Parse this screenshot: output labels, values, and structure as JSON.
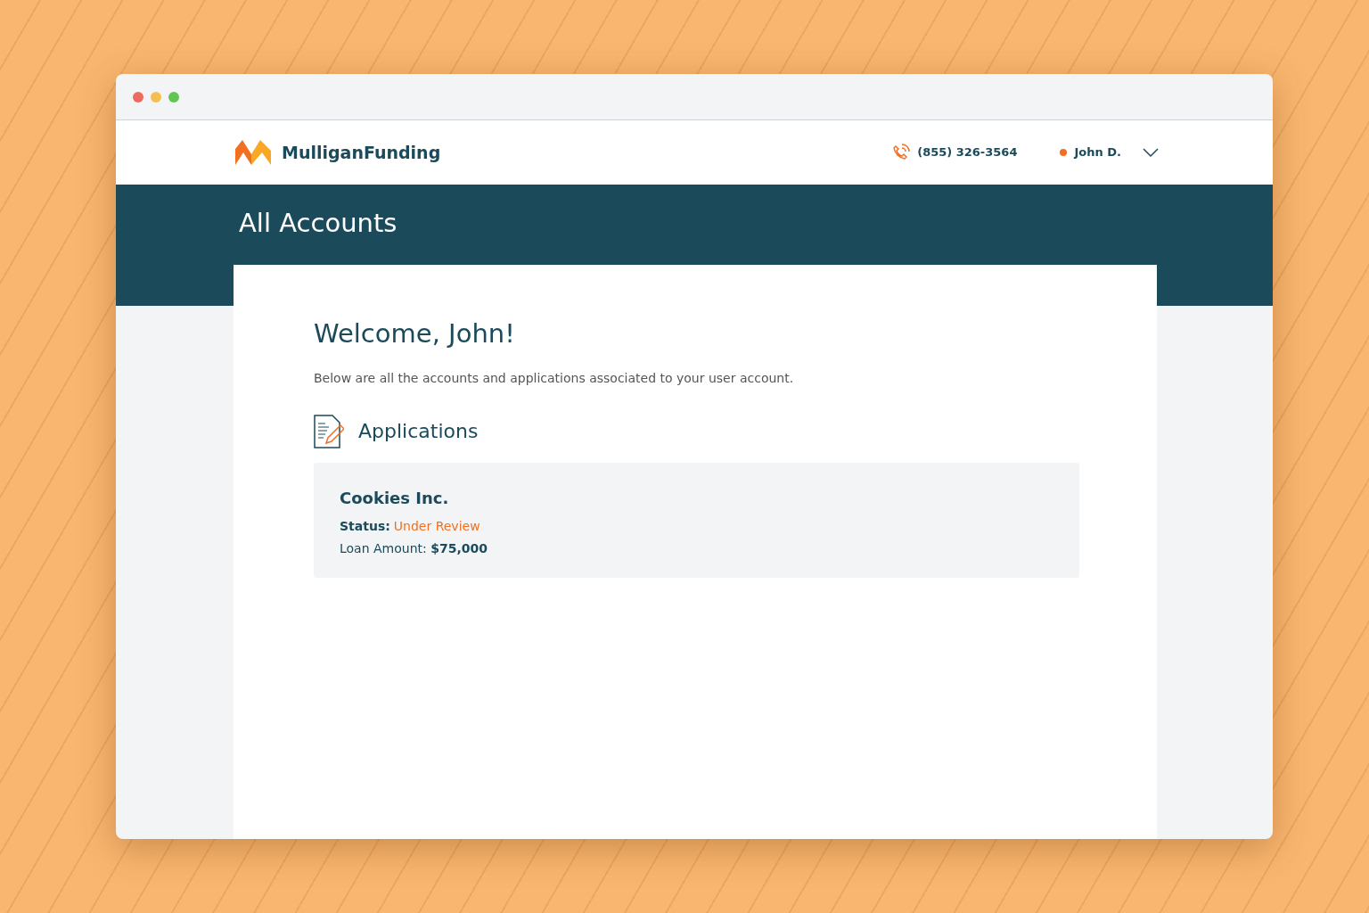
{
  "brand": {
    "name": "MulliganFunding"
  },
  "header": {
    "phone": "(855) 326-3564",
    "user": "John D."
  },
  "banner": {
    "title": "All Accounts"
  },
  "welcome": {
    "heading": "Welcome, John!",
    "intro": "Below are all the accounts and applications associated to your user account."
  },
  "applications": {
    "title": "Applications",
    "items": [
      {
        "name": "Cookies Inc.",
        "status_label": "Status:",
        "status": "Under Review",
        "loan": "Loan Amount: **$75,000**"
      }
    ]
  }
}
